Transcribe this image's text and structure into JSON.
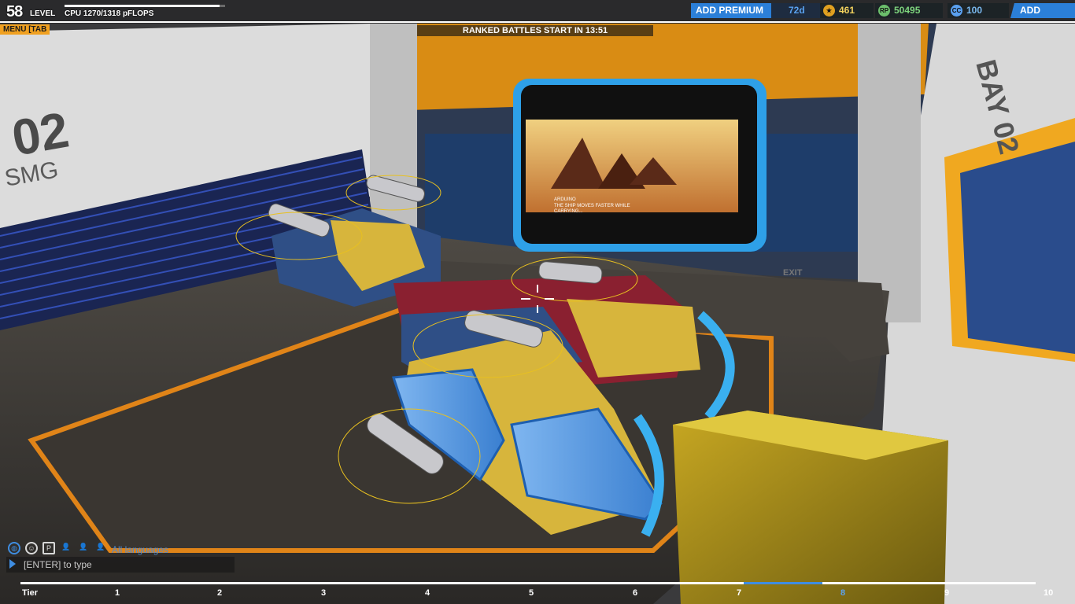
{
  "hud": {
    "level_number": "58",
    "level_label": "LEVEL",
    "cpu_text": "CPU 1270/1318 pFLOPS",
    "cpu_usage": 0.964,
    "menu_tab_label": "MENU [TAB",
    "ranked_banner": "RANKED BATTLES START IN 13:51",
    "add_premium_label": "ADD PREMIUM",
    "premium_days": "72d",
    "stars_value": "461",
    "rp_value": "50495",
    "cc_value": "100",
    "add_funds_label": "ADD FUNDS",
    "stars_icon": "star-icon",
    "rp_icon_text": "RP",
    "cc_icon_text": "CC"
  },
  "chat": {
    "language_label": "All languages",
    "input_placeholder": "[ENTER] to type",
    "icons": [
      "globe-icon",
      "accessibility-icon",
      "party-icon",
      "player-1-icon",
      "player-2-icon",
      "player-3-icon"
    ]
  },
  "tier_bar": {
    "label": "Tier",
    "ticks": [
      "1",
      "2",
      "3",
      "4",
      "5",
      "6",
      "7",
      "8",
      "9",
      "10"
    ],
    "current_tier": "8"
  },
  "scene": {
    "garage_bay_text": "02",
    "garage_bay_subtext": "r SMG",
    "right_wall_text": "BAY 02",
    "exit_label": "EXIT",
    "monitor_caption_line1": "ARDUINO",
    "monitor_caption_line2": "THE SHIP MOVES FASTER WHILE",
    "monitor_caption_line3": "CARRYING...",
    "colors": {
      "accent_orange": "#f0a020",
      "accent_blue": "#2b7fd8",
      "robot_yellow": "#d7b53c",
      "robot_blue": "#2f4f86",
      "robot_red": "#9a2230"
    }
  }
}
